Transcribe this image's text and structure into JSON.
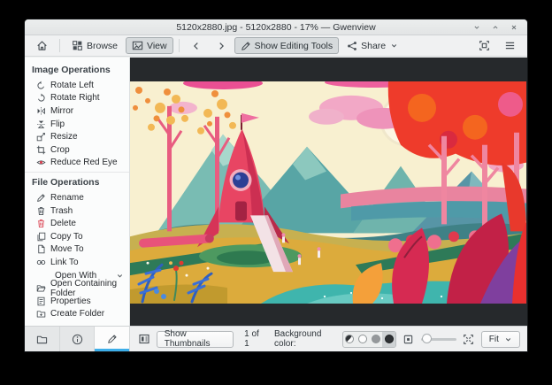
{
  "window": {
    "title": "5120x2880.jpg - 5120x2880 - 17% — Gwenview"
  },
  "toolbar": {
    "browse": "Browse",
    "view": "View",
    "show_editing_tools": "Show Editing Tools",
    "share": "Share"
  },
  "sidebar": {
    "image_operations_title": "Image Operations",
    "image_operations": [
      {
        "label": "Rotate Left",
        "icon": "rotate-left-icon"
      },
      {
        "label": "Rotate Right",
        "icon": "rotate-right-icon"
      },
      {
        "label": "Mirror",
        "icon": "mirror-icon"
      },
      {
        "label": "Flip",
        "icon": "flip-icon"
      },
      {
        "label": "Resize",
        "icon": "resize-icon"
      },
      {
        "label": "Crop",
        "icon": "crop-icon"
      },
      {
        "label": "Reduce Red Eye",
        "icon": "red-eye-icon"
      }
    ],
    "file_operations_title": "File Operations",
    "file_operations": [
      {
        "label": "Rename",
        "icon": "rename-icon"
      },
      {
        "label": "Trash",
        "icon": "trash-icon"
      },
      {
        "label": "Delete",
        "icon": "delete-icon"
      },
      {
        "label": "Copy To",
        "icon": "copy-icon"
      },
      {
        "label": "Move To",
        "icon": "move-icon"
      },
      {
        "label": "Link To",
        "icon": "link-icon"
      }
    ],
    "open_with_label": "Open With",
    "file_operations_more": [
      {
        "label": "Open Containing Folder",
        "icon": "open-folder-icon"
      },
      {
        "label": "Properties",
        "icon": "properties-icon"
      },
      {
        "label": "Create Folder",
        "icon": "new-folder-icon"
      }
    ]
  },
  "statusbar": {
    "show_thumbnails": "Show Thumbnails",
    "counter": "1 of 1",
    "background_color_label": "Background color:",
    "zoom_mode": "Fit"
  },
  "colors": {
    "accent": "#3daee9",
    "window_background": "#eff0f1",
    "sidebar_background": "#fbfcfc",
    "viewer_background": "#26292c",
    "delete_red": "#da4453"
  }
}
